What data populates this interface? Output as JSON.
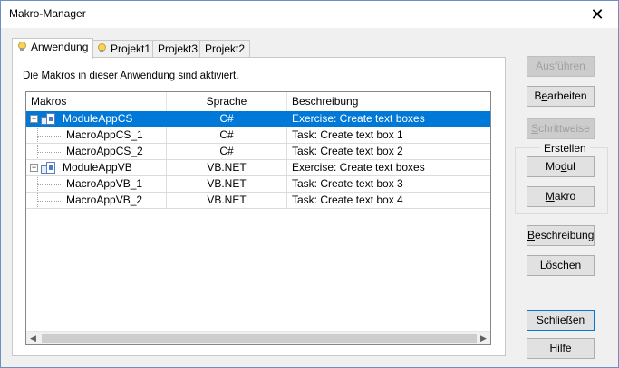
{
  "window": {
    "title": "Makro-Manager",
    "close_glyph": "✕"
  },
  "tabs": [
    {
      "label": "Anwendung",
      "icon": "bulb-icon"
    },
    {
      "label": "Projekt1",
      "icon": "bulb-icon"
    },
    {
      "label": "Projekt3"
    },
    {
      "label": "Projekt2"
    }
  ],
  "panel": {
    "info": "Die Makros in dieser Anwendung sind aktiviert."
  },
  "table": {
    "headers": [
      "Makros",
      "Sprache",
      "Beschreibung"
    ],
    "rows": [
      {
        "name": "ModuleAppCS",
        "lang": "C#",
        "desc": "Exercise: Create text boxes"
      },
      {
        "name": "MacroAppCS_1",
        "lang": "C#",
        "desc": "Task: Create text box 1"
      },
      {
        "name": "MacroAppCS_2",
        "lang": "C#",
        "desc": "Task: Create text box 2"
      },
      {
        "name": "ModuleAppVB",
        "lang": "VB.NET",
        "desc": "Exercise: Create text boxes"
      },
      {
        "name": "MacroAppVB_1",
        "lang": "VB.NET",
        "desc": "Task: Create text box 3"
      },
      {
        "name": "MacroAppVB_2",
        "lang": "VB.NET",
        "desc": "Task: Create text box 4"
      }
    ],
    "expander_glyph": "−",
    "scroll_left": "◀",
    "scroll_right": "▶"
  },
  "buttons": {
    "ausfuehren": {
      "pre": "",
      "key": "A",
      "post": "usführen"
    },
    "bearbeiten": {
      "pre": "B",
      "key": "e",
      "post": "arbeiten"
    },
    "schrittweise": {
      "pre": "",
      "key": "S",
      "post": "chrittweise"
    },
    "erstellen_group": "Erstellen",
    "modul": {
      "pre": "Mo",
      "key": "d",
      "post": "ul"
    },
    "makro": {
      "pre": "",
      "key": "M",
      "post": "akro"
    },
    "beschreibung": {
      "pre": "",
      "key": "B",
      "post": "eschreibung"
    },
    "loeschen": "Löschen",
    "schliessen": "Schließen",
    "hilfe": "Hilfe"
  }
}
